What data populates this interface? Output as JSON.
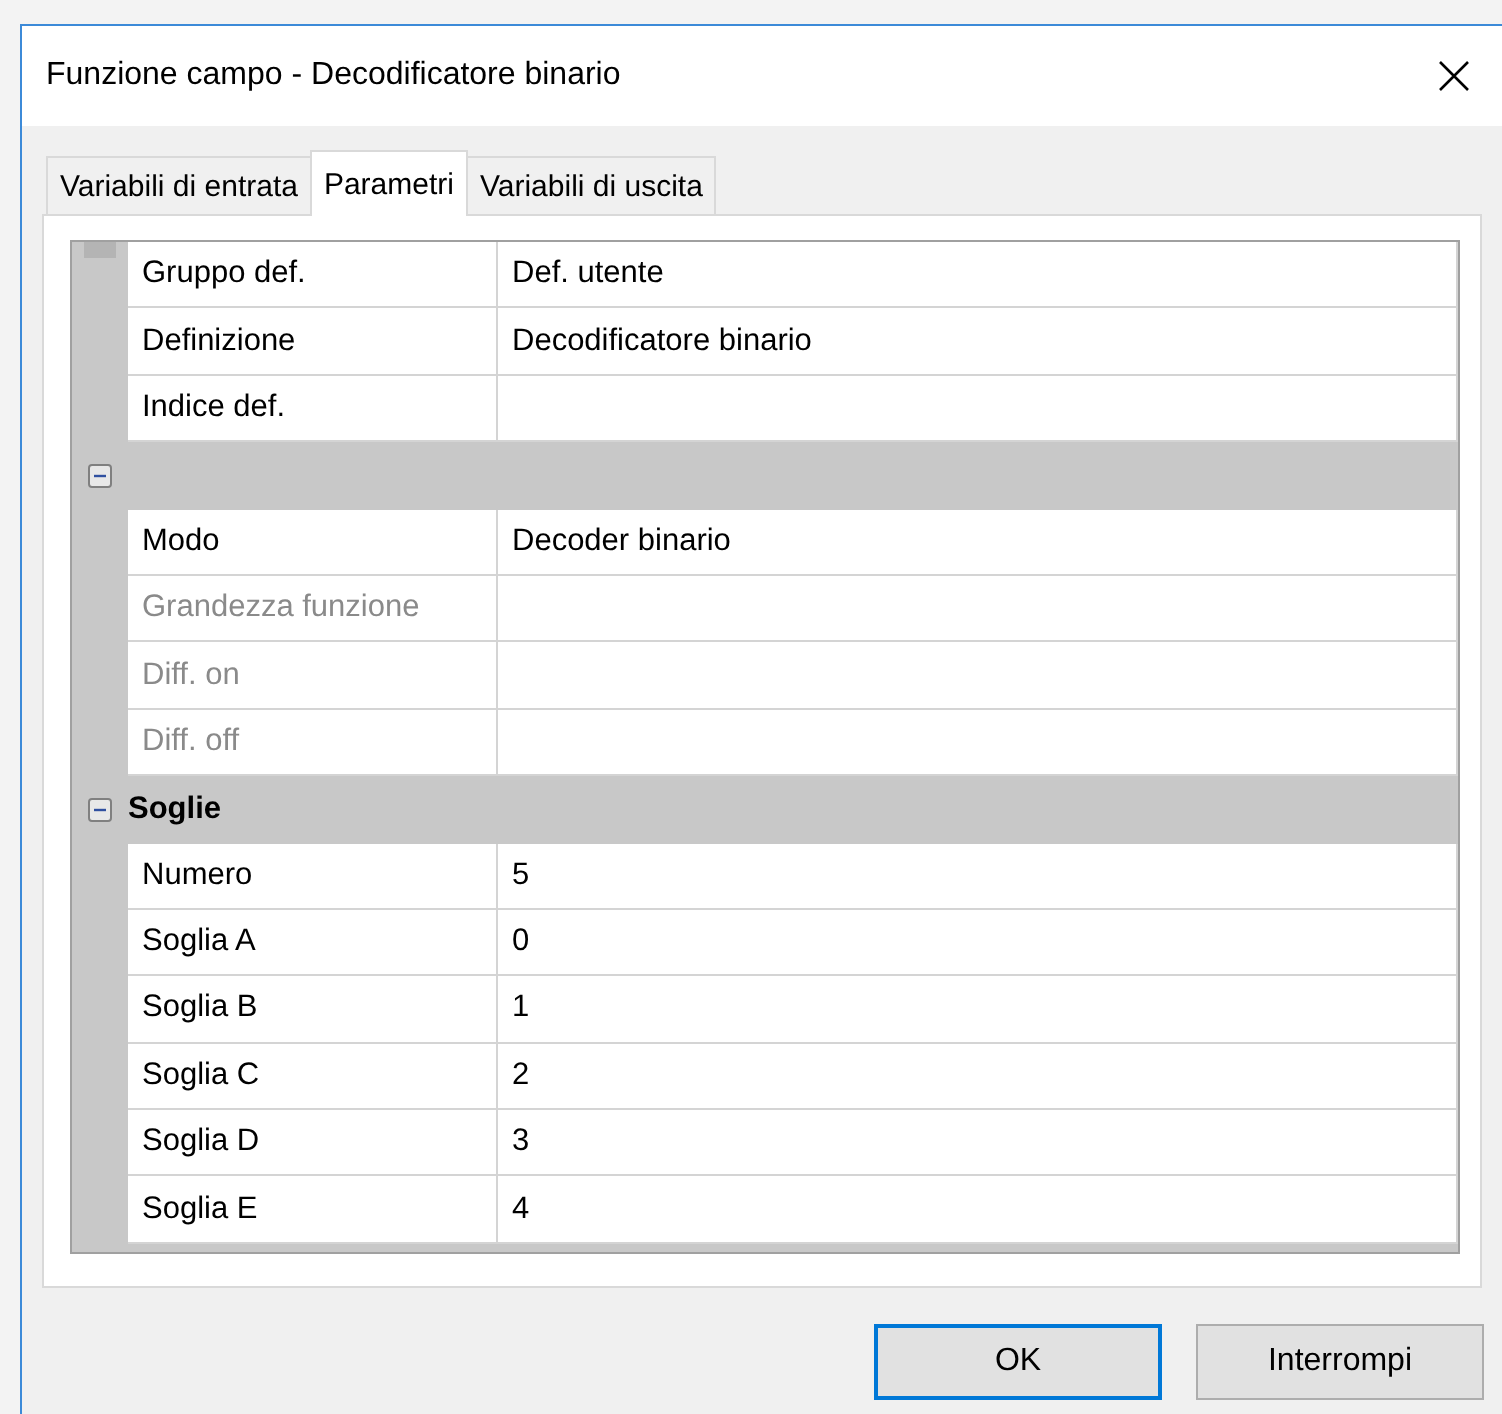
{
  "window": {
    "title": "Funzione campo - Decodificatore binario"
  },
  "tabs": [
    {
      "label": "Variabili di entrata",
      "selected": false
    },
    {
      "label": "Parametri",
      "selected": true
    },
    {
      "label": "Variabili di uscita",
      "selected": false
    }
  ],
  "sections": [
    {
      "rows": [
        {
          "label": "Gruppo def.",
          "value": "Def. utente",
          "disabled": false
        },
        {
          "label": "Definizione",
          "value": "Decodificatore binario",
          "disabled": false
        },
        {
          "label": "Indice def.",
          "disabled": false
        }
      ]
    },
    {
      "expanded": true,
      "rows": [
        {
          "label": "Modo",
          "value": "Decoder binario",
          "disabled": false
        },
        {
          "label": "Grandezza funzione",
          "disabled": true
        },
        {
          "label": "Diff. on",
          "disabled": true
        },
        {
          "label": "Diff. off",
          "disabled": true
        }
      ]
    },
    {
      "title": "Soglie",
      "expanded": true,
      "rows": [
        {
          "label": "Numero",
          "value": "5",
          "disabled": false
        },
        {
          "label": "Soglia A",
          "value": "0",
          "disabled": false
        },
        {
          "label": "Soglia B",
          "value": "1",
          "disabled": false
        },
        {
          "label": "Soglia C",
          "value": "2",
          "disabled": false
        },
        {
          "label": "Soglia D",
          "value": "3",
          "disabled": false
        },
        {
          "label": "Soglia E",
          "value": "4",
          "disabled": false
        }
      ]
    }
  ],
  "buttons": [
    {
      "label": "OK",
      "selected": true
    },
    {
      "label": "Interrompi",
      "selected": false
    }
  ]
}
